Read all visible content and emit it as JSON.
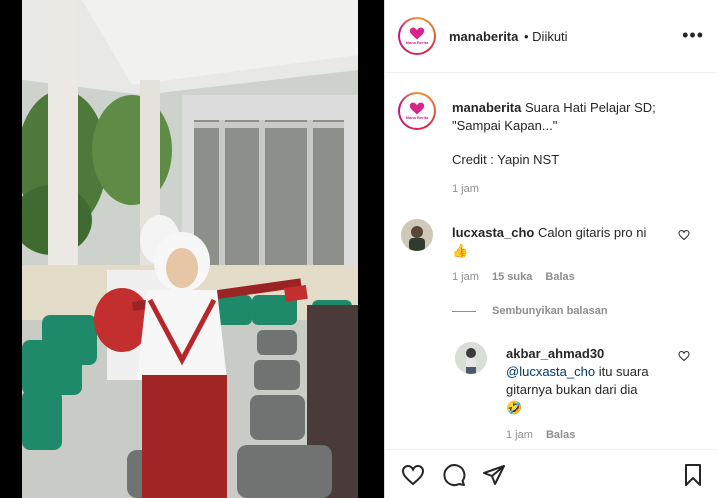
{
  "post": {
    "account": "manaberita",
    "follow_status": "• Diikuti",
    "logo_label": "Mana Berita",
    "more_label": "•••"
  },
  "caption": {
    "username": "manaberita",
    "text": "Suara Hati Pelajar SD; \"Sampai Kapan...\"",
    "credit": "Credit : Yapin NST",
    "time": "1 jam"
  },
  "comments": [
    {
      "username": "lucxasta_cho",
      "text": "Calon gitaris pro ni",
      "emoji": "👍",
      "time": "1 jam",
      "likes": "15 suka",
      "reply_label": "Balas",
      "hide_replies_label": "Sembunyikan balasan",
      "replies": [
        {
          "username": "akbar_ahmad30",
          "mention": "@lucxasta_cho",
          "text": "itu suara gitarnya bukan dari dia",
          "emoji": "🤣",
          "time": "1 jam",
          "reply_label": "Balas"
        }
      ]
    }
  ],
  "colors": {
    "link": "#00376b",
    "muted": "#8e8e8e",
    "border": "#dbdbdb",
    "brand": "#d9258b"
  },
  "icons": {
    "like": "heart-icon",
    "comment": "comment-icon",
    "share": "paper-plane-icon",
    "save": "bookmark-icon",
    "more": "more-options-icon"
  }
}
